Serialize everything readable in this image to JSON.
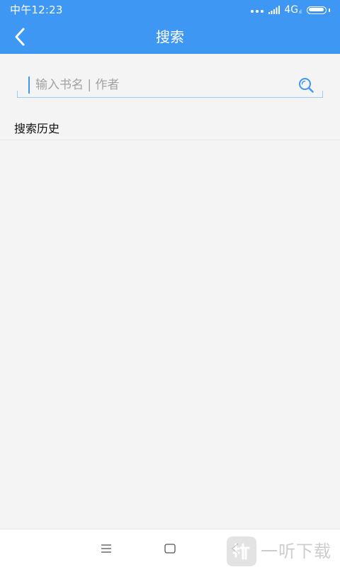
{
  "status_bar": {
    "time": "中午12:23",
    "network": "4G",
    "network_sub": "ıl",
    "icons": [
      "dots-icon",
      "signal-icon",
      "battery-icon"
    ]
  },
  "nav": {
    "title": "搜索",
    "back_icon": "chevron-left-icon"
  },
  "search": {
    "placeholder": "输入书名 | 作者",
    "value": "",
    "icon": "search-icon"
  },
  "history": {
    "title": "搜索历史",
    "items": []
  },
  "system_nav": {
    "icons": [
      "menu-icon",
      "home-icon",
      "back-icon"
    ]
  },
  "watermark": {
    "text": "一听下载"
  },
  "colors": {
    "primary": "#3e97f2",
    "background": "#f4f4f4",
    "placeholder": "#a2a2a2",
    "underline": "#9ccbf4"
  }
}
